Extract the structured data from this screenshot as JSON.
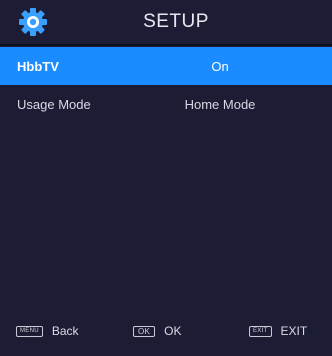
{
  "header": {
    "icon": "gear-icon",
    "title": "SETUP"
  },
  "menu": {
    "items": [
      {
        "label": "HbbTV",
        "value": "On",
        "selected": true
      },
      {
        "label": "Usage Mode",
        "value": "Home Mode",
        "selected": false
      }
    ]
  },
  "footer": {
    "back": {
      "key": "MENU",
      "label": "Back"
    },
    "ok": {
      "key": "OK",
      "label": "OK"
    },
    "exit": {
      "key": "EXIT",
      "label": "EXIT"
    }
  },
  "colors": {
    "background": "#1c1d35",
    "highlight": "#1a8cff",
    "gear_icon": "#3aa0ff"
  }
}
